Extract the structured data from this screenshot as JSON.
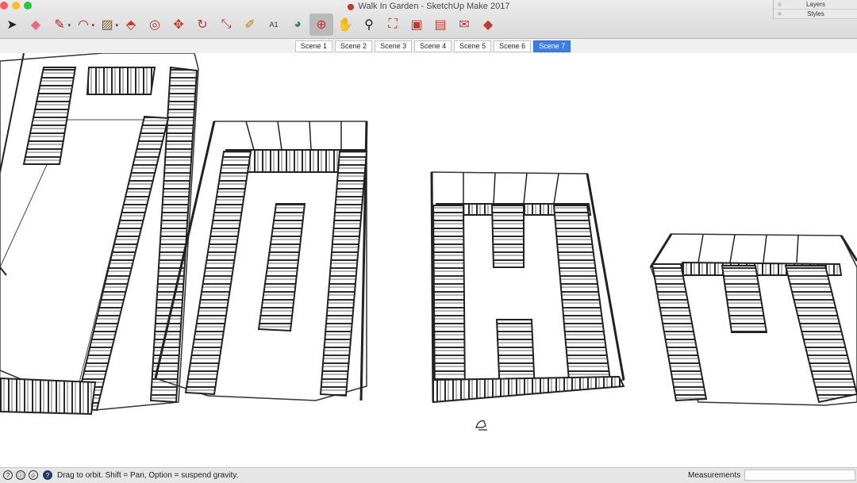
{
  "window": {
    "title": "Walk In Garden - SketchUp Make 2017"
  },
  "colors": {
    "close": "#fe5f57",
    "minimize": "#febc2e",
    "zoom": "#28c840",
    "active_tab": "#3b7ee8"
  },
  "toolbar": {
    "tools": [
      {
        "name": "select-tool-icon",
        "glyph": "➤",
        "color": "#222222"
      },
      {
        "name": "eraser-tool-icon",
        "glyph": "◆",
        "color": "#e86a8a"
      },
      {
        "name": "pencil-line-tool-icon",
        "glyph": "✎",
        "color": "#b22222",
        "dropdown": true
      },
      {
        "name": "arc-tool-icon",
        "glyph": "◠",
        "color": "#b22222",
        "dropdown": true
      },
      {
        "name": "rectangle-shape-tool-icon",
        "glyph": "▨",
        "color": "#8b5a2b",
        "dropdown": true
      },
      {
        "name": "push-pull-tool-icon",
        "glyph": "⬘",
        "color": "#c0392b"
      },
      {
        "name": "offset-tool-icon",
        "glyph": "◎",
        "color": "#c0392b"
      },
      {
        "name": "move-tool-icon",
        "glyph": "✥",
        "color": "#c0392b"
      },
      {
        "name": "rotate-tool-icon",
        "glyph": "↻",
        "color": "#c0392b"
      },
      {
        "name": "scale-tool-icon",
        "glyph": "⤡",
        "color": "#c0392b"
      },
      {
        "name": "tape-measure-tool-icon",
        "glyph": "✐",
        "color": "#b8860b"
      },
      {
        "name": "text-tool-icon",
        "glyph": "A1",
        "color": "#333333"
      },
      {
        "name": "paint-bucket-tool-icon",
        "glyph": "◕",
        "color": "#2e8b57"
      },
      {
        "name": "orbit-tool-icon",
        "glyph": "⊕",
        "color": "#c0392b",
        "active": true
      },
      {
        "name": "pan-tool-icon",
        "glyph": "✋",
        "color": "#d2a679"
      },
      {
        "name": "zoom-tool-icon",
        "glyph": "⚲",
        "color": "#222222"
      },
      {
        "name": "zoom-extents-tool-icon",
        "glyph": "⛶",
        "color": "#c0392b"
      },
      {
        "name": "3d-warehouse-icon",
        "glyph": "▣",
        "color": "#c0392b"
      },
      {
        "name": "extension-warehouse-icon",
        "glyph": "▤",
        "color": "#c0392b"
      },
      {
        "name": "send-to-layout-icon",
        "glyph": "✉",
        "color": "#c0392b"
      },
      {
        "name": "extension-manager-icon",
        "glyph": "◆",
        "color": "#c0392b"
      }
    ]
  },
  "tray": {
    "layers_label": "Layers",
    "styles_label": "Styles"
  },
  "scenes": {
    "tabs": [
      "Scene 1",
      "Scene 2",
      "Scene 3",
      "Scene 4",
      "Scene 5",
      "Scene 6",
      "Scene 7"
    ],
    "active": "Scene 7"
  },
  "status": {
    "message": "Drag to orbit. Shift = Pan, Option = suspend gravity."
  },
  "measurements": {
    "label": "Measurements",
    "value": ""
  }
}
